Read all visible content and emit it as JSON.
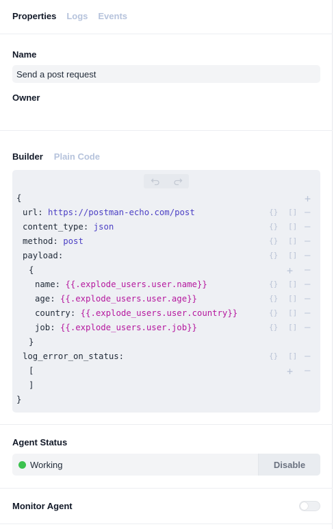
{
  "tabs": [
    {
      "label": "Properties"
    },
    {
      "label": "Logs"
    },
    {
      "label": "Events"
    }
  ],
  "name": {
    "label": "Name",
    "value": "Send a post request"
  },
  "owner": {
    "label": "Owner"
  },
  "builder": {
    "tabs": [
      {
        "label": "Builder"
      },
      {
        "label": "Plain Code"
      }
    ],
    "undo_icon": "undo-icon",
    "redo_icon": "redo-icon",
    "code": {
      "open_brace": "{",
      "url_key": "url:",
      "url_value": "https://postman-echo.com/post",
      "content_type_key": "content_type:",
      "content_type_value": "json",
      "method_key": "method:",
      "method_value": "post",
      "payload_key": "payload:",
      "payload_open": "{",
      "name_key": "name:",
      "name_value": "{{.explode_users.user.name}}",
      "age_key": "age:",
      "age_value": "{{.explode_users.user.age}}",
      "country_key": "country:",
      "country_value": "{{.explode_users.user.country}}",
      "job_key": "job:",
      "job_value": "{{.explode_users.user.job}}",
      "payload_close": "}",
      "log_error_key": "log_error_on_status:",
      "array_open": "[",
      "array_close": "]",
      "close_brace": "}"
    },
    "controls": {
      "object": "{}",
      "array": "[]",
      "add": "+",
      "remove": "—"
    }
  },
  "agent_status": {
    "label": "Agent Status",
    "status": "Working",
    "status_color": "#3cc24f",
    "button": "Disable"
  },
  "monitor": {
    "label": "Monitor Agent",
    "enabled": false
  }
}
